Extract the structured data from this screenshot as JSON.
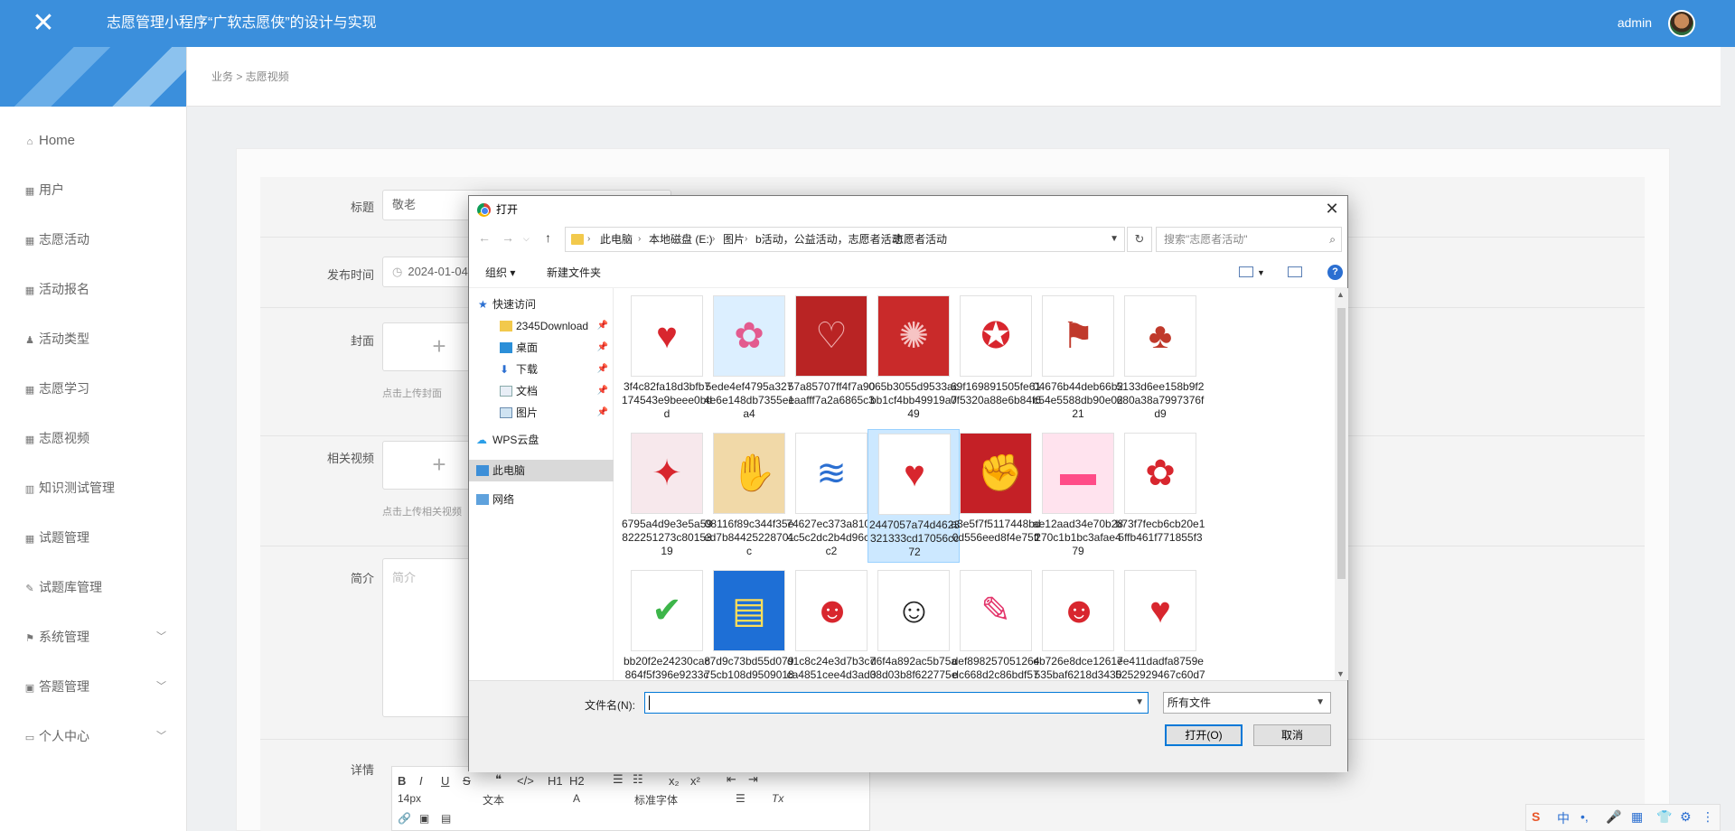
{
  "app": {
    "title": "志愿管理小程序“广软志愿侠”的设计与实现",
    "user": "admin"
  },
  "sidebar": {
    "items": [
      {
        "label": "Home",
        "icon": "home-icon"
      },
      {
        "label": "用户",
        "icon": "grid-icon"
      },
      {
        "label": "志愿活动",
        "icon": "grid-icon"
      },
      {
        "label": "活动报名",
        "icon": "grid-icon"
      },
      {
        "label": "活动类型",
        "icon": "person-icon"
      },
      {
        "label": "志愿学习",
        "icon": "grid-icon"
      },
      {
        "label": "志愿视频",
        "icon": "grid-icon"
      },
      {
        "label": "知识测试管理",
        "icon": "chart-icon"
      },
      {
        "label": "试题管理",
        "icon": "grid-icon"
      },
      {
        "label": "试题库管理",
        "icon": "edit-icon"
      },
      {
        "label": "系统管理",
        "icon": "flag-icon"
      },
      {
        "label": "答题管理",
        "icon": "card-icon"
      },
      {
        "label": "个人中心",
        "icon": "window-icon"
      }
    ]
  },
  "breadcrumb": {
    "root": "业务",
    "sep": ">",
    "current": "志愿视频"
  },
  "form": {
    "title_label": "标题",
    "title_value": "敬老",
    "date_label": "发布时间",
    "date_value": "2024-01-04",
    "cover_label": "封面",
    "cover_hint": "点击上传封面",
    "video_label": "相关视频",
    "video_hint": "点击上传相关视频",
    "intro_label": "简介",
    "intro_placeholder": "简介",
    "detail_label": "详情",
    "editor": {
      "font_size": "14px",
      "block": "文本",
      "font": "标准字体"
    }
  },
  "dialog": {
    "title": "打开",
    "path": [
      "此电脑",
      "本地磁盘 (E:)",
      "图片",
      "b活动，公益活动，志愿者活动",
      "志愿者活动"
    ],
    "search_placeholder": "搜索\"志愿者活动\"",
    "organize": "组织",
    "new_folder": "新建文件夹",
    "nav": {
      "quick_access": "快速访问",
      "items": [
        "2345Download",
        "桌面",
        "下载",
        "文档",
        "图片"
      ],
      "wps": "WPS云盘",
      "this_pc": "此电脑",
      "network": "网络"
    },
    "files": [
      "3f4c82fa18d3bfb7174543e9beee0bdd",
      "5ede4ef4795a3274e6e148db7355eea4",
      "57a85707ff4f7a901aafff7a2a6865c3",
      "065b3055d9533acbb1cf4bb49919a749",
      "69f169891505fe610f5320a88e6b84f6",
      "04676b44deb66b2c54e5588db90e0221",
      "5133d6ee158b9f2680a38a7997376fd9",
      "6795a4d9e3e5a59822251273c8015319",
      "08116f89c344f35eed7b84425228701c",
      "74627ec373a81004c5c2dc2b4d96cec2",
      "2447057a74d4623321333cd17056cc72",
      "a3e5f7f5117448bd0d556eed8f4e75ff",
      "ae12aad34e70b28270c1b1bc3afae479",
      "b73f7fecb6cb20e15ffb461f771855f3",
      "bb20f2e24230ca8864f5f396e9233c",
      "c7d9c73bd55d07975cb108d95090185",
      "d1c8c24e3d7b3c7ca4851cee4d3ad0f",
      "d6f4a892ac5b75a38d03b8f622775ed0",
      "def898257051264dc668d2c86bdf571",
      "eb726e8dce12617535baf6218d3430",
      "ee411dadfa8759e5252929467c60d7"
    ],
    "filename_label": "文件名(N):",
    "filetype": "所有文件",
    "open_btn": "打开(O)",
    "cancel_btn": "取消"
  },
  "ime": {
    "lang": "中"
  },
  "colors": {
    "accent": "#3b8fdc",
    "heart_red": "#d8262e"
  }
}
